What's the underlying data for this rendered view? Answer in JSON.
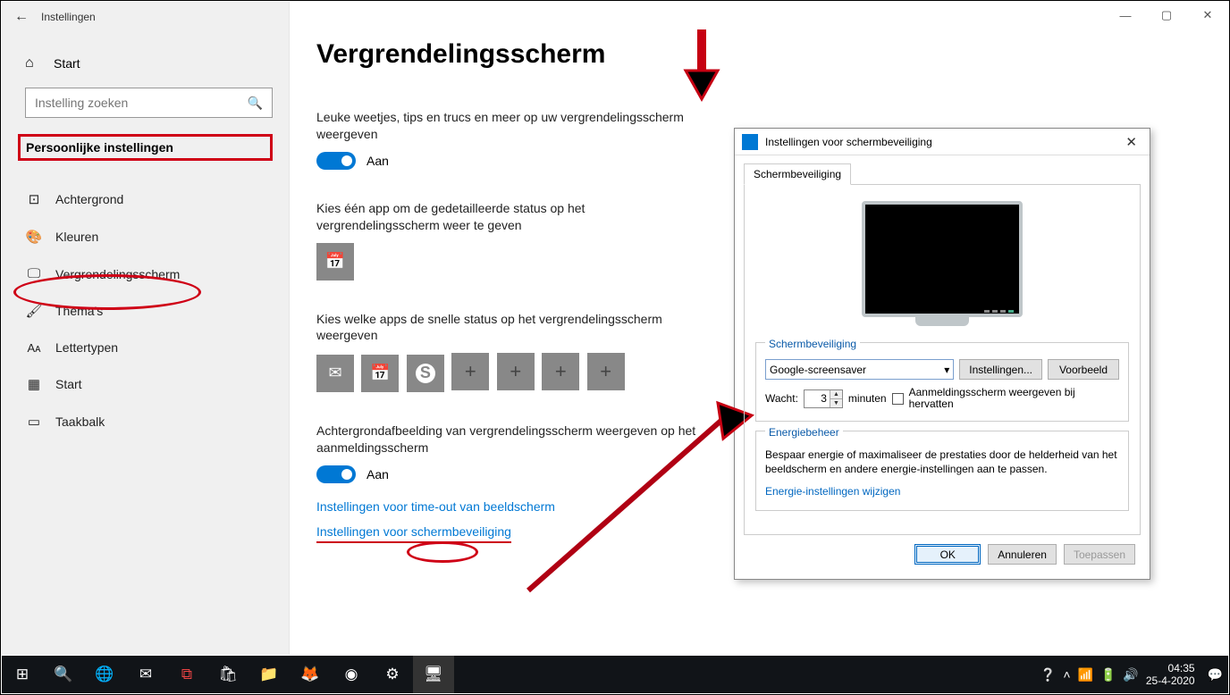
{
  "window": {
    "title": "Instellingen",
    "min": "—",
    "max": "▢",
    "close": "✕",
    "back": "←"
  },
  "sidebar": {
    "home": "Start",
    "search_placeholder": "Instelling zoeken",
    "section": "Persoonlijke instellingen",
    "items": [
      {
        "icon": "▭",
        "label": "Achtergrond"
      },
      {
        "icon": "◐",
        "label": "Kleuren"
      },
      {
        "icon": "▢",
        "label": "Vergrendelingsscherm"
      },
      {
        "icon": "✎",
        "label": "Thema's"
      },
      {
        "icon": "Aᴀ",
        "label": "Lettertypen"
      },
      {
        "icon": "▦",
        "label": "Start"
      },
      {
        "icon": "▭",
        "label": "Taakbalk"
      }
    ]
  },
  "main": {
    "heading": "Vergrendelingsscherm",
    "tips_label": "Leuke weetjes, tips en trucs en meer op uw vergrendelingsscherm weergeven",
    "tips_state": "Aan",
    "detailed_label": "Kies één app om de gedetailleerde status op het vergrendelingsscherm weer te geven",
    "quick_label": "Kies welke apps de snelle status op het vergrendelingsscherm weergeven",
    "bg_label": "Achtergrondafbeelding van vergrendelingsscherm weergeven op het aanmeldingsscherm",
    "bg_state": "Aan",
    "link_timeout_pre": "Instellingen voor ",
    "link_timeout_mid": "time-out",
    "link_timeout_post": " van beeldscherm",
    "link_screensaver": "Instellingen voor schermbeveiliging"
  },
  "dialog": {
    "title": "Instellingen voor schermbeveiliging",
    "tab": "Schermbeveiliging",
    "group_ss": "Schermbeveiliging",
    "select_value": "Google-screensaver",
    "btn_settings": "Instellingen...",
    "btn_preview": "Voorbeeld",
    "wait_label": "Wacht:",
    "wait_value": "3",
    "wait_unit": "minuten",
    "resume_label": "Aanmeldingsscherm weergeven bij hervatten",
    "group_power": "Energiebeheer",
    "power_text": "Bespaar energie of maximaliseer de prestaties door de helderheid van het beeldscherm en andere energie-instellingen aan te passen.",
    "power_link": "Energie-instellingen wijzigen",
    "ok": "OK",
    "cancel": "Annuleren",
    "apply": "Toepassen"
  },
  "taskbar": {
    "time": "04:35",
    "date": "25-4-2020"
  }
}
